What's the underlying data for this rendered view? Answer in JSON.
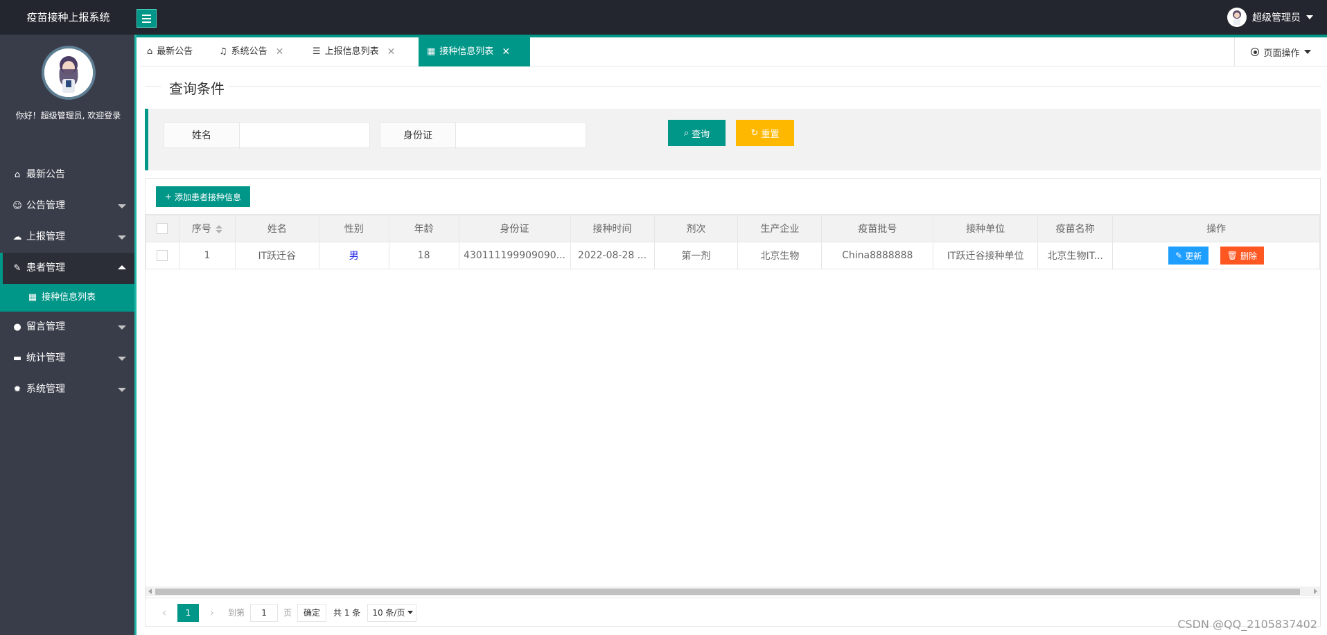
{
  "app": {
    "title": "疫苗接种上报系统"
  },
  "header": {
    "user_name": "超级管理员"
  },
  "sidebar": {
    "welcome": "你好！超级管理员, 欢迎登录",
    "items": [
      {
        "label": "最新公告",
        "icon": "home-icon"
      },
      {
        "label": "公告管理",
        "icon": "smile-icon"
      },
      {
        "label": "上报管理",
        "icon": "cloud-upload-icon"
      },
      {
        "label": "患者管理",
        "icon": "edit-note-icon",
        "expanded": true
      },
      {
        "label": "留言管理",
        "icon": "chat-icon"
      },
      {
        "label": "统计管理",
        "icon": "monitor-icon"
      },
      {
        "label": "系统管理",
        "icon": "gear-icon"
      }
    ],
    "sub_item": {
      "label": "接种信息列表",
      "icon": "table-icon"
    }
  },
  "tabs": [
    {
      "label": "最新公告",
      "icon": "home-icon"
    },
    {
      "label": "系统公告",
      "icon": "bell-icon"
    },
    {
      "label": "上报信息列表",
      "icon": "list-icon"
    },
    {
      "label": "接种信息列表",
      "icon": "table-icon",
      "active": true
    }
  ],
  "page_ops": {
    "label": "页面操作"
  },
  "query": {
    "legend": "查询条件",
    "name_label": "姓名",
    "name_value": "",
    "id_label": "身份证",
    "id_value": "",
    "search_btn": "查询",
    "reset_btn": "重置"
  },
  "toolbar": {
    "add_btn": "添加患者接种信息"
  },
  "table": {
    "columns": [
      "序号",
      "姓名",
      "性别",
      "年龄",
      "身份证",
      "接种时间",
      "剂次",
      "生产企业",
      "疫苗批号",
      "接种单位",
      "疫苗名称",
      "操作"
    ],
    "rows": [
      {
        "index": "1",
        "name": "IT跃迁谷",
        "gender": "男",
        "age": "18",
        "id_card": "430111199909090...",
        "time": "2022-08-28 ...",
        "dose": "第一剂",
        "maker": "北京生物",
        "batch": "China8888888",
        "unit": "IT跃迁谷接种单位",
        "vaccine": "北京生物IT...",
        "edit_btn": "更新",
        "delete_btn": "删除"
      }
    ]
  },
  "pager": {
    "current_page": "1",
    "goto_label": "到第",
    "goto_value": "1",
    "page_unit": "页",
    "confirm": "确定",
    "total": "共 1 条",
    "per_page": "10 条/页"
  },
  "watermark": "CSDN @QQ_2105837402",
  "colors": {
    "primary": "#009688",
    "warning": "#ffb800",
    "info": "#1e9fff",
    "danger": "#ff5722",
    "sidebar": "#393d49",
    "header": "#23262e"
  }
}
